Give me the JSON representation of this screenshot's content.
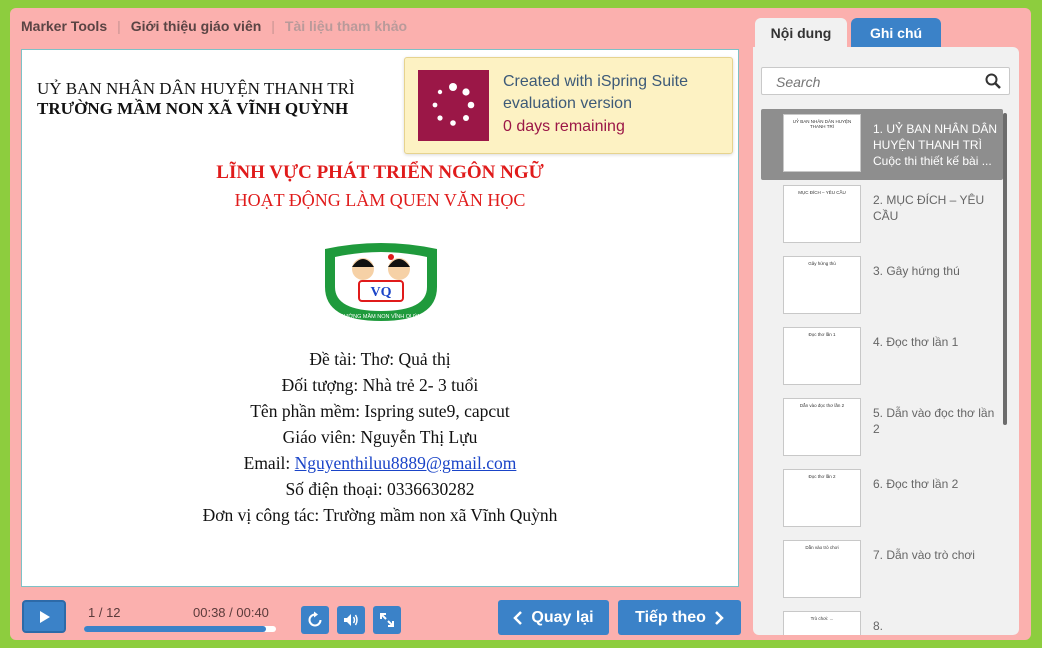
{
  "nav": {
    "marker_tools": "Marker Tools",
    "teacher_intro": "Giới thiệu giáo viên",
    "references": "Tài liệu tham khảo"
  },
  "slide": {
    "org_line1": "UỶ BAN NHÂN DÂN HUYỆN THANH TRÌ",
    "org_line2": "TRƯỜNG MẦM NON XÃ VĨNH QUỲNH",
    "heading1": "LĨNH VỰC PHÁT TRIỂN NGÔN NGỮ",
    "heading2": "HOẠT ĐỘNG LÀM QUEN VĂN HỌC",
    "logo_text": "VQ",
    "logo_ring_text": "TRƯỜNG MẦM NON VĨNH QUỲNH",
    "topic": "Đề tài: Thơ: Quả thị",
    "audience": "Đối tượng: Nhà trẻ 2- 3 tuổi",
    "software": "Tên phần mềm: Ispring sute9, capcut",
    "teacher": "Giáo viên: Nguyễn Thị Lựu",
    "email_label": "Email: ",
    "email": "Nguyenthiluu8889@gmail.com",
    "phone": "Số điện thoại: 0336630282",
    "workplace": "Đơn vị công tác: Trường mầm non xã Vĩnh Quỳnh"
  },
  "trial": {
    "line1": "Created with iSpring Suite evaluation version",
    "line2": "0 days remaining"
  },
  "player": {
    "slide_counter": "1 / 12",
    "time": "00:38 / 00:40",
    "progress": 0.95,
    "prev_label": "Quay lại",
    "next_label": "Tiếp theo"
  },
  "sidebar": {
    "tab_content": "Nội dung",
    "tab_notes": "Ghi chú",
    "search_placeholder": "Search",
    "items": [
      {
        "title": "1. UỶ BAN NHÂN DÂN HUYỆN THANH TRÌ",
        "subtitle": "Cuộc thi thiết kế bài ...",
        "thumb": "UỶ BAN NHÂN DÂN HUYỆN THANH TRÌ"
      },
      {
        "title": "2. MỤC ĐÍCH – YÊU CẦU",
        "thumb": "MỤC ĐÍCH – YÊU CẦU"
      },
      {
        "title": "3. Gây hứng thú",
        "thumb": "Gây hứng thú"
      },
      {
        "title": "4. Đọc thơ lần 1",
        "thumb": "Đọc thơ lần 1"
      },
      {
        "title": "5. Dẫn vào đọc thơ lần 2",
        "thumb": "Dẫn vào đọc thơ lần 2"
      },
      {
        "title": "6. Đọc thơ lần 2",
        "thumb": "Đọc thơ lần 2"
      },
      {
        "title": "7. Dẫn vào trò chơi",
        "thumb": "Dẫn vào trò chơi"
      },
      {
        "title": "8.",
        "thumb": "Trò chơi: ..."
      }
    ]
  },
  "colors": {
    "accent": "#3b82c8",
    "frame": "#fbb0ae",
    "outer": "#8dcd3e",
    "ispring": "#9b1747"
  }
}
